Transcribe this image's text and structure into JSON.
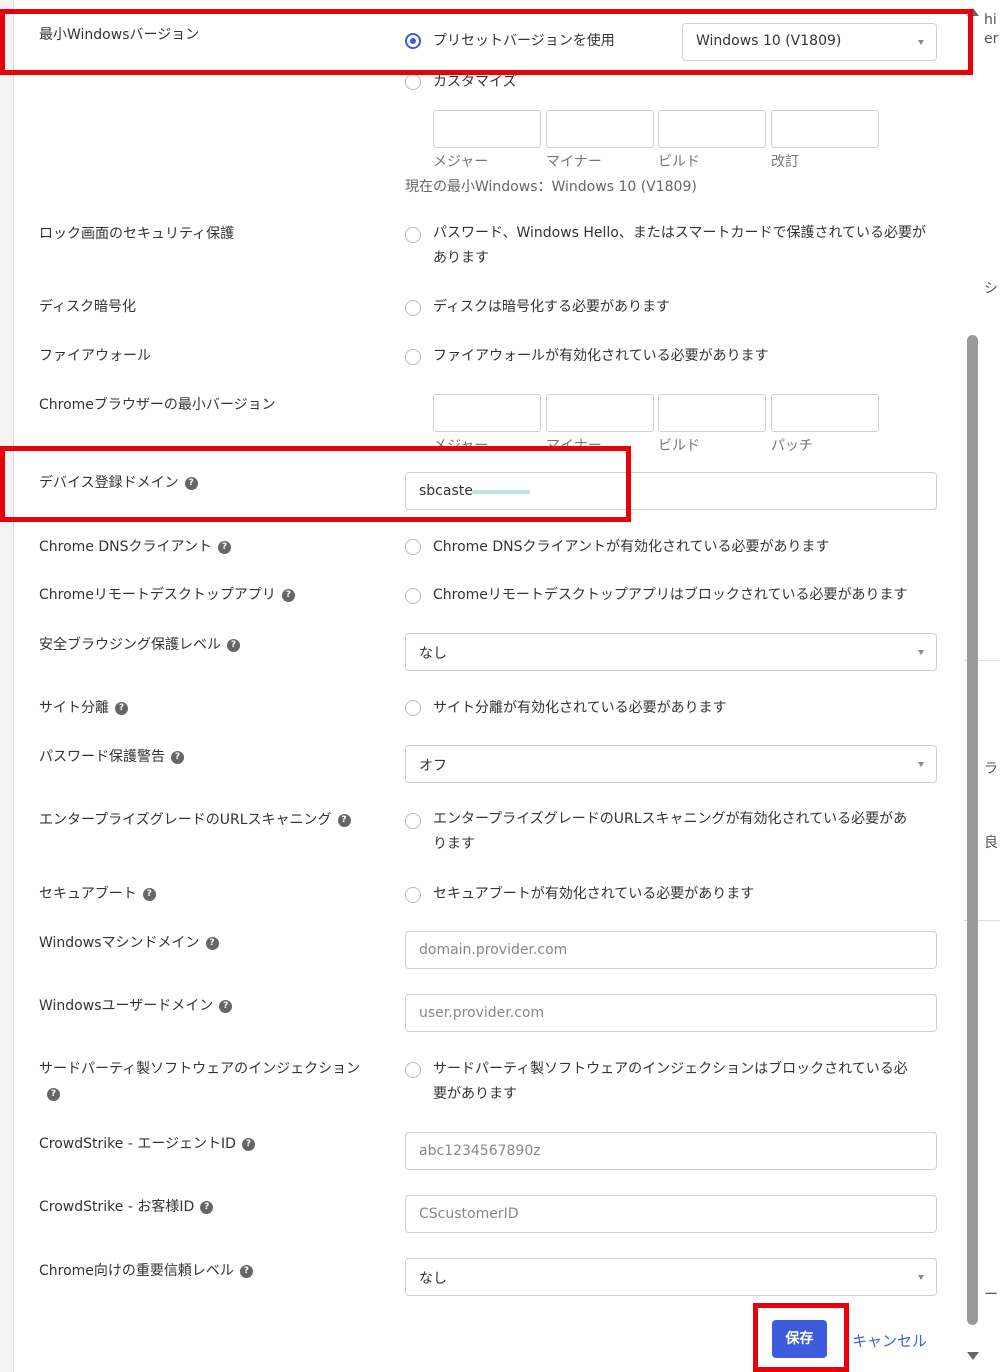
{
  "background_fragments": [
    "hi",
    "er",
    "シ",
    "ラ",
    "良",
    "ー"
  ],
  "settings": {
    "min_windows": {
      "label": "最小Windowsバージョン",
      "preset_option": "プリセットバージョンを使用",
      "preset_value": "Windows 10 (V1809)",
      "custom_option": "カスタマイズ",
      "field_labels": [
        "メジャー",
        "マイナー",
        "ビルド",
        "改訂"
      ],
      "current": "現在の最小Windows：Windows 10 (V1809)"
    },
    "lock_screen": {
      "label": "ロック画面のセキュリティ保護",
      "option": "パスワード、Windows Hello、またはスマートカードで保護されている必要があります"
    },
    "disk_encryption": {
      "label": "ディスク暗号化",
      "option": "ディスクは暗号化する必要があります"
    },
    "firewall": {
      "label": "ファイアウォール",
      "option": "ファイアウォールが有効化されている必要があります"
    },
    "chrome_min_version": {
      "label": "Chromeブラウザーの最小バージョン",
      "field_labels": [
        "メジャー",
        "マイナー",
        "ビルド",
        "パッチ"
      ]
    },
    "device_domain": {
      "label": "デバイス登録ドメイン",
      "value": "sbcaste"
    },
    "chrome_dns": {
      "label": "Chrome DNSクライアント",
      "option": "Chrome DNSクライアントが有効化されている必要があります"
    },
    "chrome_remote": {
      "label": "Chromeリモートデスクトップアプリ",
      "option": "Chromeリモートデスクトップアプリはブロックされている必要があります"
    },
    "safe_browsing": {
      "label": "安全ブラウジング保護レベル",
      "value": "なし"
    },
    "site_isolation": {
      "label": "サイト分離",
      "option": "サイト分離が有効化されている必要があります"
    },
    "password_warning": {
      "label": "パスワード保護警告",
      "value": "オフ"
    },
    "enterprise_url": {
      "label": "エンタープライズグレードのURLスキャニング",
      "option": "エンタープライズグレードのURLスキャニングが有効化されている必要があります"
    },
    "secure_boot": {
      "label": "セキュアブート",
      "option": "セキュアブートが有効化されている必要があります"
    },
    "win_machine_domain": {
      "label": "Windowsマシンドメイン",
      "placeholder": "domain.provider.com"
    },
    "win_user_domain": {
      "label": "Windowsユーザードメイン",
      "placeholder": "user.provider.com"
    },
    "third_party": {
      "label": "サードパーティ製ソフトウェアのインジェクション",
      "option": "サードパーティ製ソフトウェアのインジェクションはブロックされている必要があります"
    },
    "cs_agent": {
      "label": "CrowdStrike - エージェントID",
      "placeholder": "abc1234567890z"
    },
    "cs_customer": {
      "label": "CrowdStrike - お客様ID",
      "placeholder": "CScustomerID"
    },
    "chrome_trust": {
      "label": "Chrome向けの重要信頼レベル",
      "value": "なし"
    }
  },
  "footer": {
    "save": "保存",
    "cancel": "キャンセル"
  },
  "colors": {
    "accent": "#3b5ddd",
    "annotation": "#e8000b"
  }
}
